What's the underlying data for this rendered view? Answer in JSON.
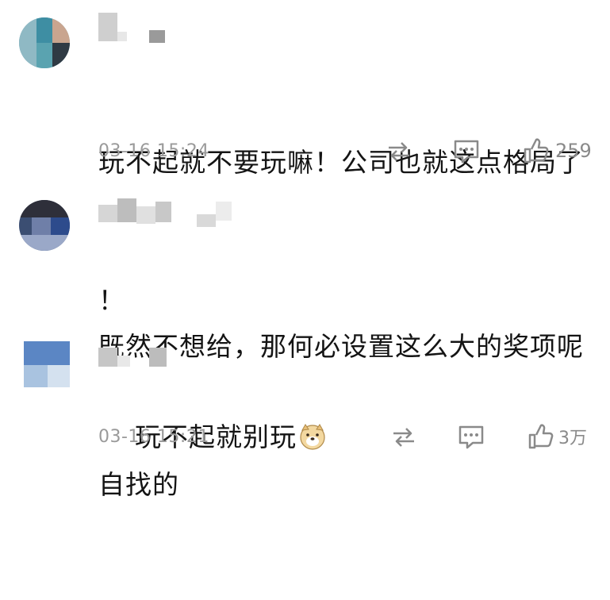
{
  "comments": [
    {
      "text_line1": "玩不起就不要玩嘛！公司也就这点格局了",
      "text_line2": "！",
      "time": "03-16 15:24",
      "like_count": "259",
      "icons": {
        "repost": "repost-icon",
        "reply": "comment-icon",
        "like": "thumbs-up-icon"
      }
    },
    {
      "text_line1": "既然不想给，那何必设置这么大的奖项呢",
      "text_line2": "自找的"
    },
    {
      "text_line1": "玩不起就别玩",
      "emoji": "doge-emoji",
      "time": "03-16 15:21",
      "like_count": "3万",
      "icons": {
        "repost": "repost-icon",
        "reply": "comment-icon",
        "like": "thumbs-up-icon"
      }
    }
  ],
  "colors": {
    "text": "#141414",
    "meta": "#9a9a9a",
    "icon": "#8a8a8a"
  }
}
